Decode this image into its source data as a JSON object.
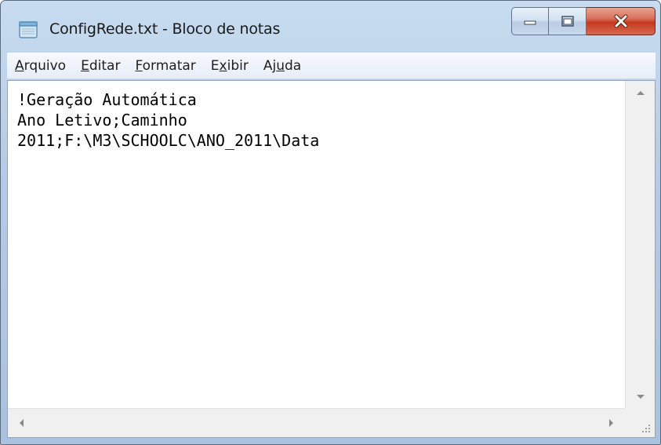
{
  "window": {
    "title": "ConfigRede.txt - Bloco de notas",
    "icon": "notepad-icon",
    "caption_buttons": {
      "minimize_icon": "minimize-icon",
      "maximize_icon": "maximize-icon",
      "close_icon": "close-icon"
    },
    "colors": {
      "frame": "#b4cbe5",
      "close_button": "#c43a1f"
    }
  },
  "menubar": {
    "items": [
      {
        "label": "Arquivo",
        "mnemonic": "A"
      },
      {
        "label": "Editar",
        "mnemonic": "E"
      },
      {
        "label": "Formatar",
        "mnemonic": "F"
      },
      {
        "label": "Exibir",
        "mnemonic": "x"
      },
      {
        "label": "Ajuda",
        "mnemonic": "u"
      }
    ]
  },
  "document": {
    "lines": [
      "!Geração Automática",
      "Ano Letivo;Caminho",
      "2011;F:\\M3\\SCHOOLC\\ANO_2011\\Data"
    ]
  }
}
